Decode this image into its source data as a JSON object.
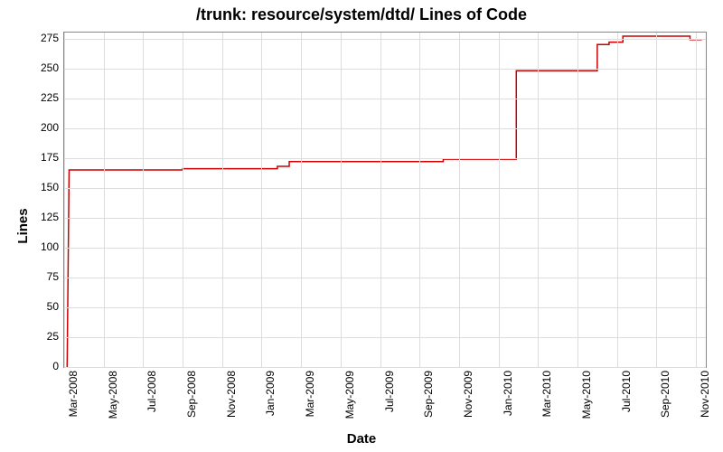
{
  "chart_data": {
    "type": "line",
    "title": "/trunk: resource/system/dtd/ Lines of Code",
    "xlabel": "Date",
    "ylabel": "Lines",
    "ylim": [
      0,
      280
    ],
    "yticks": [
      0,
      25,
      50,
      75,
      100,
      125,
      150,
      175,
      200,
      225,
      250,
      275
    ],
    "x_categories": [
      "Mar-2008",
      "May-2008",
      "Jul-2008",
      "Sep-2008",
      "Nov-2008",
      "Jan-2009",
      "Mar-2009",
      "May-2009",
      "Jul-2009",
      "Sep-2009",
      "Nov-2009",
      "Jan-2010",
      "Mar-2010",
      "May-2010",
      "Jul-2010",
      "Sep-2010",
      "Nov-2010"
    ],
    "x_range_months": [
      0,
      32.5
    ],
    "series": [
      {
        "name": "lines-of-code",
        "color": "#cc0000",
        "points": [
          {
            "x": 0.15,
            "y": 0
          },
          {
            "x": 0.25,
            "y": 165
          },
          {
            "x": 6.0,
            "y": 165
          },
          {
            "x": 6.0,
            "y": 166
          },
          {
            "x": 10.8,
            "y": 166
          },
          {
            "x": 10.8,
            "y": 168
          },
          {
            "x": 11.4,
            "y": 168
          },
          {
            "x": 11.4,
            "y": 172
          },
          {
            "x": 19.2,
            "y": 172
          },
          {
            "x": 19.2,
            "y": 174
          },
          {
            "x": 22.9,
            "y": 174
          },
          {
            "x": 22.9,
            "y": 248
          },
          {
            "x": 27.0,
            "y": 248
          },
          {
            "x": 27.0,
            "y": 270
          },
          {
            "x": 27.6,
            "y": 270
          },
          {
            "x": 27.6,
            "y": 272
          },
          {
            "x": 28.3,
            "y": 272
          },
          {
            "x": 28.3,
            "y": 277
          },
          {
            "x": 31.7,
            "y": 277
          },
          {
            "x": 31.7,
            "y": 274
          },
          {
            "x": 32.3,
            "y": 274
          }
        ]
      }
    ]
  }
}
